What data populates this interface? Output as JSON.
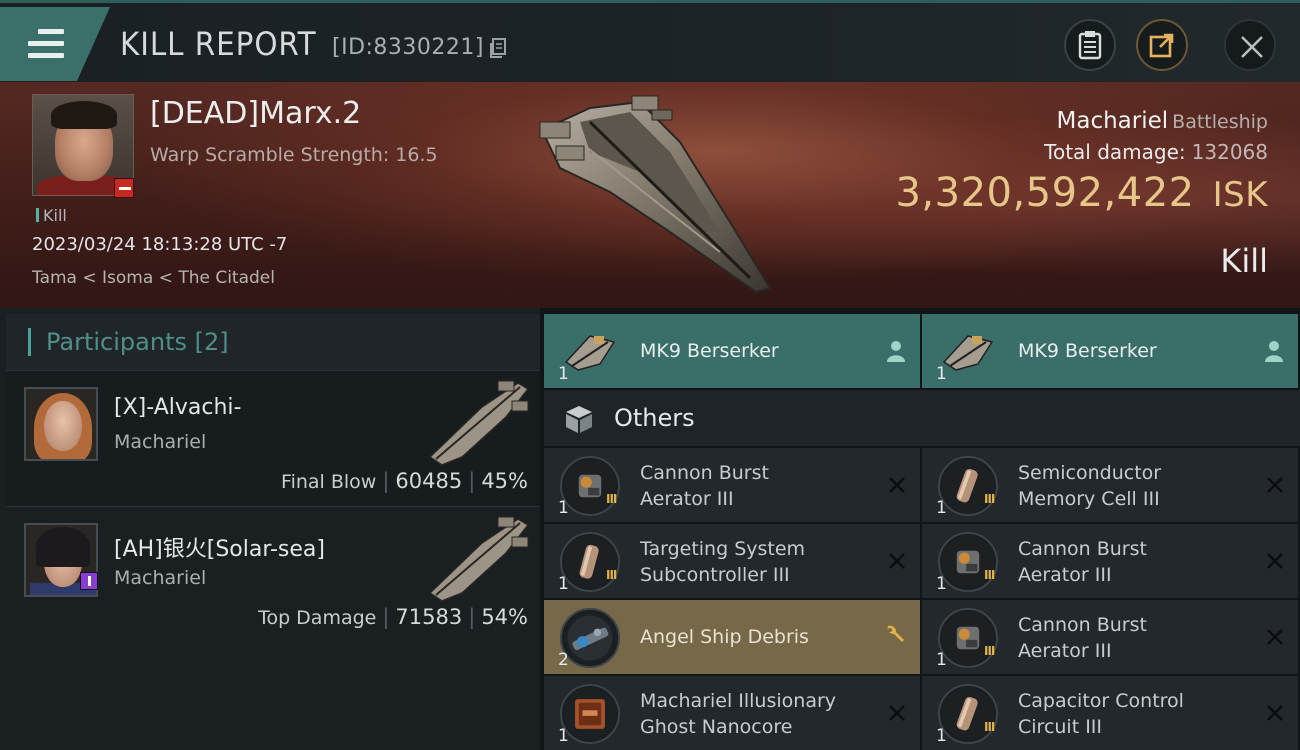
{
  "header": {
    "title": "KILL REPORT",
    "report_id": "[ID:8330221]"
  },
  "victim": {
    "name": "[DEAD]Marx.2",
    "subtitle": "Warp Scramble Strength: 16.5",
    "tag": "Kill",
    "datetime": "2023/03/24 18:13:28 UTC -7",
    "location": "Tama < Isoma < The Citadel",
    "ship": "Machariel",
    "ship_class": "Battleship",
    "total_damage_label": "Total damage:",
    "total_damage": "132068",
    "isk_value": "3,320,592,422",
    "isk_unit": "ISK",
    "result": "Kill"
  },
  "participants": {
    "title": "Participants [2]",
    "list": [
      {
        "name": "[X]-Alvachi-",
        "ship": "Machariel",
        "role": "Final Blow",
        "damage": "60485",
        "percent": "45%"
      },
      {
        "name": "[AH]银火[Solar-sea]",
        "ship": "Machariel",
        "role": "Top Damage",
        "damage": "71583",
        "percent": "54%"
      }
    ]
  },
  "drones": [
    {
      "qty": "1",
      "name": "MK9  Berserker"
    },
    {
      "qty": "1",
      "name": "MK9  Berserker"
    }
  ],
  "others_title": "Others",
  "items": [
    {
      "qty": "1",
      "line1": "Cannon Burst",
      "line2": "Aerator III",
      "meta": "III"
    },
    {
      "qty": "1",
      "line1": "Semiconductor",
      "line2": "Memory Cell III",
      "meta": "III"
    },
    {
      "qty": "1",
      "line1": "Targeting System",
      "line2": "Subcontroller III",
      "meta": "III"
    },
    {
      "qty": "1",
      "line1": "Cannon Burst",
      "line2": "Aerator III",
      "meta": "III"
    },
    {
      "qty": "2",
      "line1": "Angel Ship Debris",
      "line2": ""
    },
    {
      "qty": "1",
      "line1": "Cannon Burst",
      "line2": "Aerator III",
      "meta": "III"
    },
    {
      "qty": "1",
      "line1": "Machariel Illusionary",
      "line2": "Ghost Nanocore"
    },
    {
      "qty": "1",
      "line1": "Capacitor Control",
      "line2": "Circuit III",
      "meta": "III"
    }
  ],
  "colors": {
    "accent_teal": "#3a6f69",
    "isk_gold": "#e6c689",
    "highlight_gold": "#77684a",
    "banner_red": "#5a2c24"
  },
  "icons": {
    "menu": "menu-icon",
    "copy": "copy-icon",
    "clipboard": "clipboard-icon",
    "share": "share-icon",
    "close": "close-icon",
    "others": "cube-icon",
    "remove": "x-icon",
    "pilot": "person-icon",
    "salvage": "wrench-icon"
  }
}
